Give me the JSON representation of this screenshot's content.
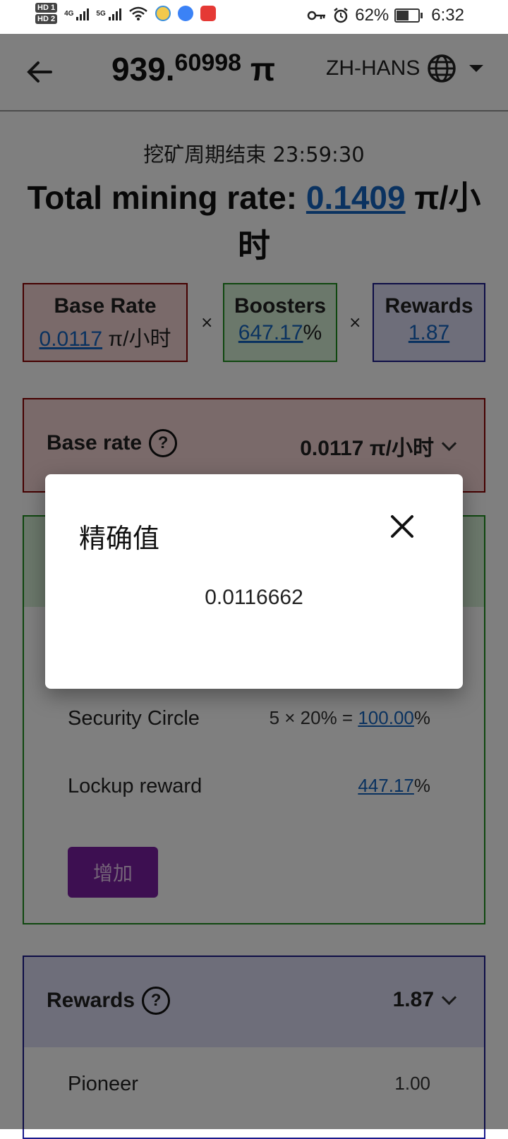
{
  "status_bar": {
    "hd1": "HD 1",
    "hd2": "HD 2",
    "net1": "4G",
    "net2": "5G",
    "battery_percent": "62%",
    "battery_level": 0.62,
    "time": "6:32",
    "icons": [
      "signal-icon",
      "wifi-icon",
      "app-notification-icon",
      "key-icon",
      "alarm-icon",
      "battery-icon"
    ]
  },
  "header": {
    "balance_int": "939.",
    "balance_frac": "60998",
    "balance_unit": "π",
    "language": "ZH-HANS"
  },
  "mining": {
    "cycle_text": "挖矿周期结束 23:59:30",
    "total_label": "Total mining rate:",
    "total_value": "0.1409",
    "total_unit_a": "π/小",
    "total_unit_b": "时"
  },
  "tiles": {
    "base_title": "Base Rate",
    "base_value": "0.0117",
    "base_unit": "π/小时",
    "boosters_title": "Boosters",
    "boosters_value": "647.17",
    "boosters_unit": "%",
    "rewards_title": "Rewards",
    "rewards_value": "1.87",
    "times_symbol": "×"
  },
  "panels": {
    "base_rate": {
      "title": "Base rate",
      "help": "?",
      "value": "0.0117 π/小时"
    },
    "boosters": {
      "security_label": "Security Circle",
      "security_formula": "5 × 20% = ",
      "security_value": "100.00",
      "security_unit": "%",
      "lockup_label": "Lockup reward",
      "lockup_value": "447.17",
      "lockup_unit": "%",
      "add_button": "增加"
    },
    "rewards": {
      "title": "Rewards",
      "help": "?",
      "value": "1.87",
      "pioneer_label": "Pioneer",
      "pioneer_value": "1.00"
    }
  },
  "modal": {
    "title": "精确值",
    "value": "0.0116662"
  },
  "colors": {
    "base_bg": "#f4d4d4",
    "base_border": "#8b0000",
    "boost_bg": "#d6f0d6",
    "boost_border": "#1e8e1e",
    "reward_bg": "#dcdcf4",
    "reward_border": "#1a1a8c",
    "link": "#1565c0",
    "button": "#7b1fa2"
  }
}
